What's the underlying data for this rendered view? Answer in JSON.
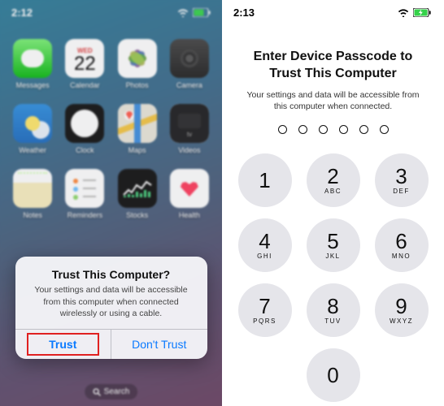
{
  "left": {
    "time": "2:12",
    "apps": [
      {
        "name": "Messages",
        "icon": "messages"
      },
      {
        "name": "Calendar",
        "icon": "calendar",
        "wd": "WED",
        "day": "22"
      },
      {
        "name": "Photos",
        "icon": "photos"
      },
      {
        "name": "Camera",
        "icon": "camera"
      },
      {
        "name": "Weather",
        "icon": "weather"
      },
      {
        "name": "Clock",
        "icon": "clock"
      },
      {
        "name": "Maps",
        "icon": "maps"
      },
      {
        "name": "Videos",
        "icon": "videos"
      },
      {
        "name": "Notes",
        "icon": "notes"
      },
      {
        "name": "Reminders",
        "icon": "reminders"
      },
      {
        "name": "Stocks",
        "icon": "stocks"
      },
      {
        "name": "Health",
        "icon": "health"
      }
    ],
    "search_label": "Search",
    "alert": {
      "title": "Trust This Computer?",
      "message": "Your settings and data will be accessible from this computer when connected wirelessly or using a cable.",
      "trust": "Trust",
      "dont": "Don't Trust"
    }
  },
  "right": {
    "time": "2:13",
    "title": "Enter Device Passcode to Trust This Computer",
    "subtitle": "Your settings and data will be accessible from this computer when connected.",
    "passcode_length": 6,
    "keys": [
      {
        "n": "1",
        "l": ""
      },
      {
        "n": "2",
        "l": "ABC"
      },
      {
        "n": "3",
        "l": "DEF"
      },
      {
        "n": "4",
        "l": "GHI"
      },
      {
        "n": "5",
        "l": "JKL"
      },
      {
        "n": "6",
        "l": "MNO"
      },
      {
        "n": "7",
        "l": "PQRS"
      },
      {
        "n": "8",
        "l": "TUV"
      },
      {
        "n": "9",
        "l": "WXYZ"
      },
      {
        "n": "0",
        "l": ""
      }
    ]
  },
  "colors": {
    "ios_blue": "#0a7aff",
    "highlight": "#e02020",
    "battery": "#35d24a"
  }
}
